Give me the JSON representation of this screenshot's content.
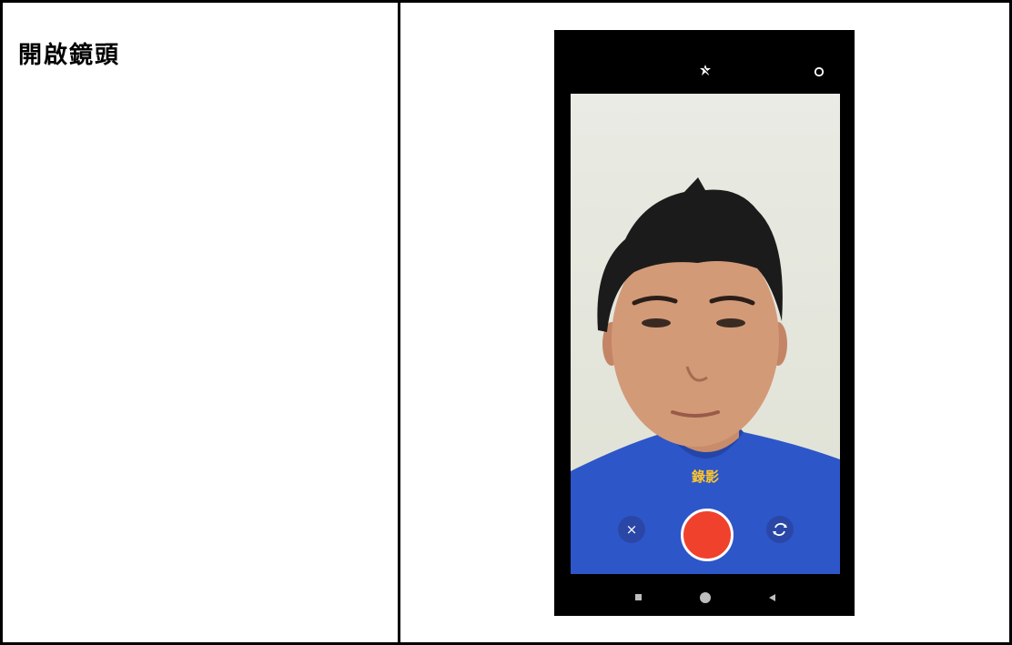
{
  "step": {
    "label": "開啟鏡頭"
  },
  "camera": {
    "mode_label": "錄影",
    "close_glyph": "×",
    "colors": {
      "record": "#f0412d",
      "mode_text": "#ffc62a",
      "shirt": "#2d56c8"
    }
  },
  "icons": [
    "flash-off-icon",
    "settings-icon",
    "close-icon",
    "record-button",
    "switch-camera-icon",
    "nav-recents-icon",
    "nav-home-icon",
    "nav-back-icon"
  ]
}
